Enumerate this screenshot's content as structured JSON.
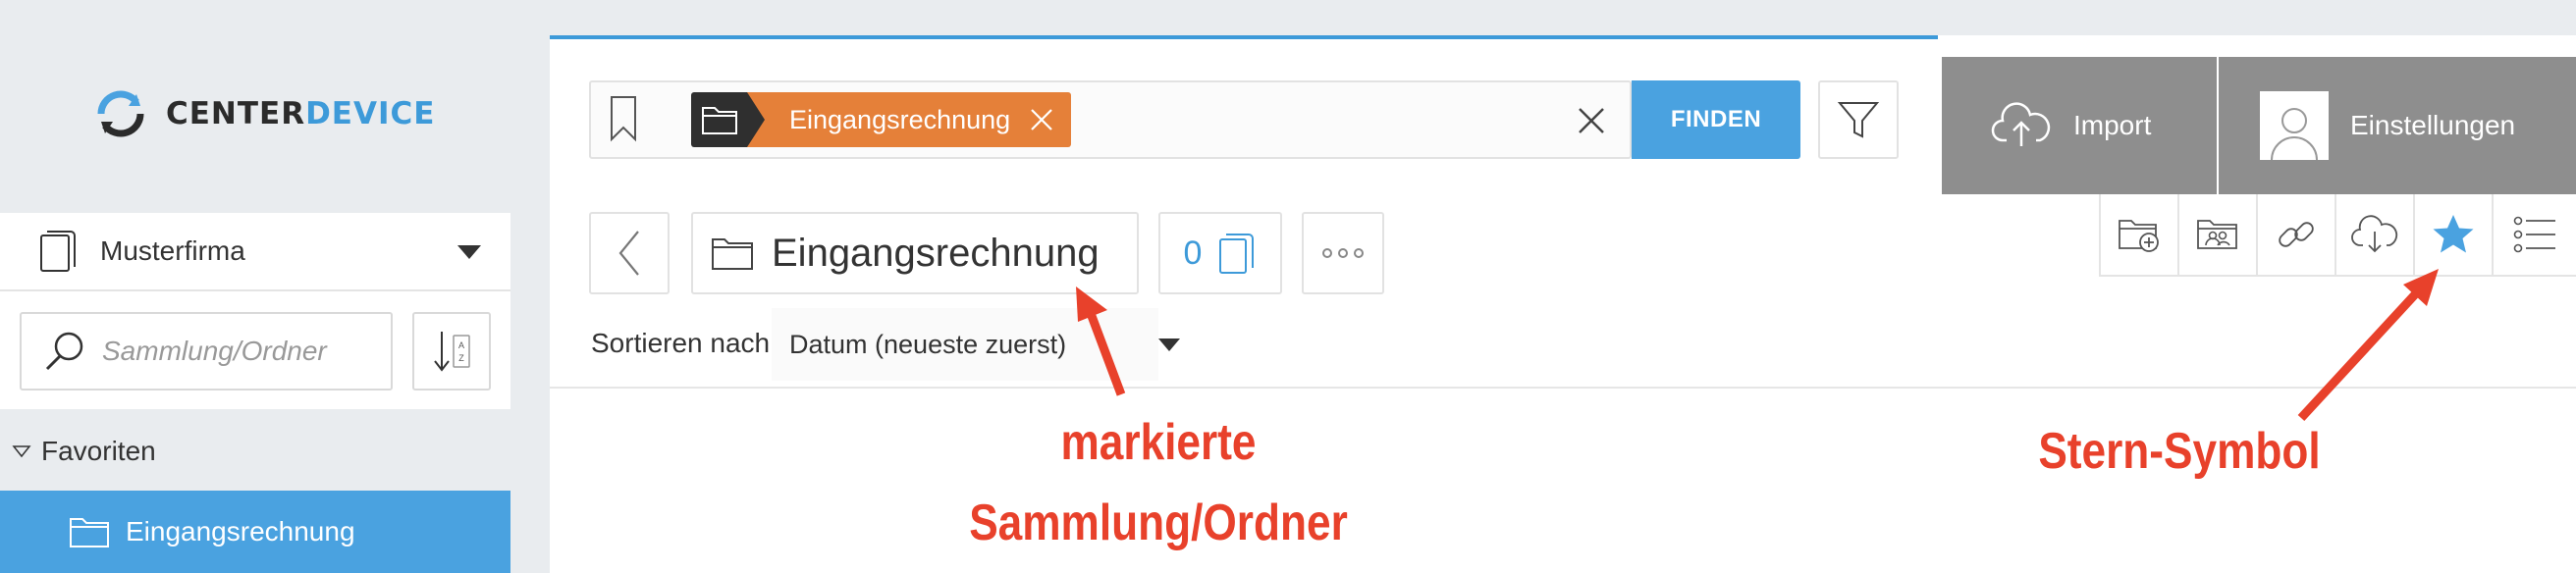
{
  "logo": {
    "text_part1": "CENTER",
    "text_part2": "DEVICE",
    "icon": "centerdevice-logo-icon"
  },
  "sidebar": {
    "company": "Musterfirma",
    "search_placeholder": "Sammlung/Ordner",
    "sort_icon_text": "A Z",
    "favorites_header": "Favoriten",
    "favorites": [
      {
        "label": "Eingangsrechnung",
        "selected": true
      }
    ]
  },
  "search": {
    "tag_label": "Eingangsrechnung",
    "find_button": "FINDEN"
  },
  "header_buttons": {
    "import": "Import",
    "settings": "Einstellungen"
  },
  "toolbar": {
    "icons": [
      "folder-add-icon",
      "shared-folder-icon",
      "link-icon",
      "cloud-download-icon",
      "star-icon",
      "list-icon"
    ],
    "star_color": "#4aa2e0"
  },
  "folder": {
    "title": "Eingangsrechnung",
    "document_count": "0"
  },
  "sort": {
    "label": "Sortieren nach:",
    "value": "Datum (neueste zuerst)"
  },
  "annotations": {
    "folder_note_line1": "markierte",
    "folder_note_line2": "Sammlung/Ordner",
    "star_note": "Stern-Symbol",
    "color": "#e8412b"
  },
  "colors": {
    "accent": "#4aa2e0",
    "tag": "#e58039",
    "header_button": "#8e8e8e"
  }
}
